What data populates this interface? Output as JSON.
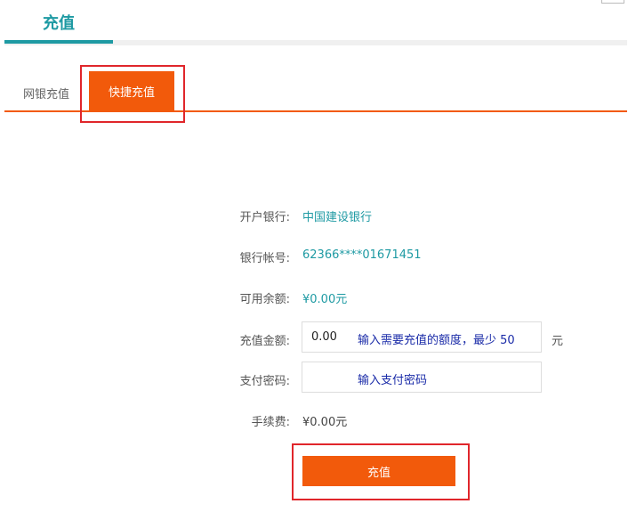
{
  "header": {
    "title": "充值"
  },
  "tabs": [
    {
      "label": "网银充值",
      "active": false
    },
    {
      "label": "快捷充值",
      "active": true
    }
  ],
  "form": {
    "bank_label": "开户银行:",
    "bank_value": "中国建设银行",
    "account_label": "银行帐号:",
    "account_value": "62366****01671451",
    "balance_label": "可用余额:",
    "balance_value": "¥0.00元",
    "amount_label": "充值金额:",
    "amount_value": "0.00",
    "amount_hint": "输入需要充值的额度，最少 50",
    "amount_unit": "元",
    "password_label": "支付密码:",
    "password_hint": "输入支付密码",
    "fee_label": "手续费:",
    "fee_value": "¥0.00元",
    "submit_label": "充值"
  },
  "colors": {
    "accent": "#f25a0b",
    "teal": "#1e9aa3",
    "highlight": "#e0262b",
    "hint": "#1a2ba8"
  }
}
